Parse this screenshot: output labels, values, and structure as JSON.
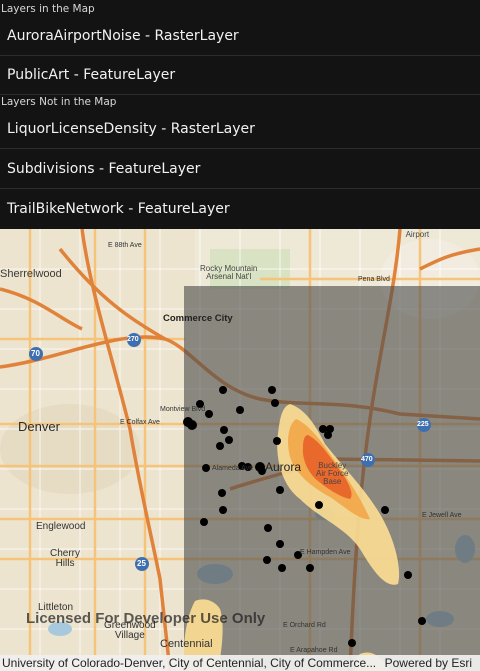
{
  "sections": {
    "in_map": {
      "header": "Layers in the Map",
      "layers": [
        "AuroraAirportNoise - RasterLayer",
        "PublicArt - FeatureLayer"
      ]
    },
    "not_in_map": {
      "header": "Layers Not in the Map",
      "layers": [
        "LiquorLicenseDensity - RasterLayer",
        "Subdivisions - FeatureLayer",
        "TrailBikeNetwork - FeatureLayer"
      ]
    }
  },
  "map": {
    "labels": {
      "sherrelwood": "Sherrelwood",
      "denver": "Denver",
      "commerce_city": "Commerce City",
      "aurora": "Aurora",
      "englewood": "Englewood",
      "cherry_hills": "Cherry\nHills",
      "littleton": "Littleton",
      "greenwood": "Greenwood\nVillage",
      "centennial": "Centennial",
      "rocky_mountain": "Rocky Mountain\nArsenal Nat'l",
      "denver_intl": "Denver Intl\nAirport",
      "buckley": "Buckley\nAir Force\nBase",
      "montview": "Montview Blvd",
      "colfax": "E Colfax Ave",
      "alameda": "Alameda Ave",
      "jewell": "E Jewell Ave",
      "hampden": "E Hampden Ave",
      "orchard": "E Orchard Rd",
      "arapahoe": "E Arapahoe Rd",
      "pena": "Pena Blvd",
      "e88th": "E 88th Ave",
      "i70": "70",
      "i270": "270",
      "i25": "25",
      "i470": "470",
      "i225": "225"
    },
    "watermark": "Licensed For Developer Use Only",
    "attribution": "University of Colorado-Denver, City of Centennial, City of Commerce...",
    "powered_by": "Powered by Esri"
  },
  "colors": {
    "panel_background": "#131313",
    "noise_dark": "#e8642a",
    "noise_mid": "#f2a94d",
    "noise_light": "#fadb92",
    "overlay_tint": "#4d4d4d",
    "public_art_points": "#000000"
  }
}
